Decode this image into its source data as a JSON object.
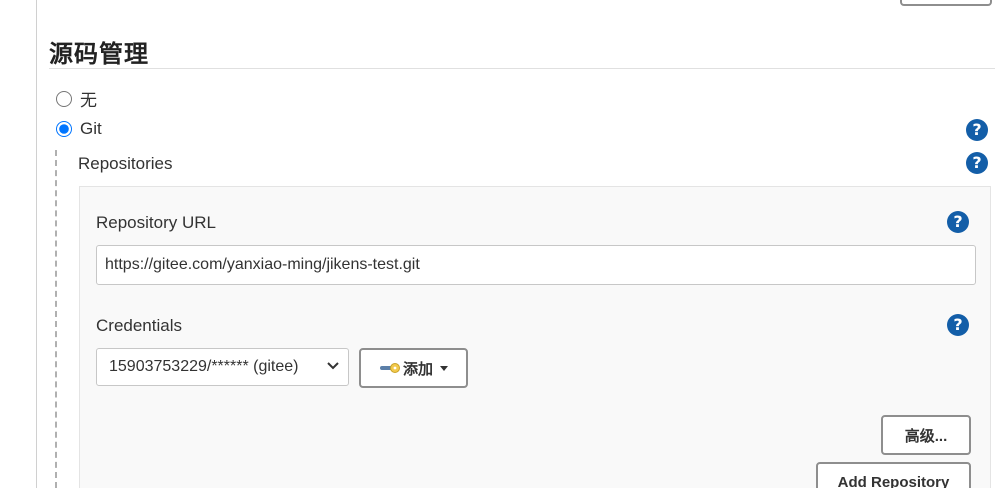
{
  "scm": {
    "title": "源码管理",
    "options": [
      {
        "label": "无",
        "selected": false
      },
      {
        "label": "Git",
        "selected": true
      }
    ]
  },
  "git": {
    "repositories_label": "Repositories",
    "repository_url": {
      "label": "Repository URL",
      "value": "https://gitee.com/yanxiao-ming/jikens-test.git"
    },
    "credentials": {
      "label": "Credentials",
      "selected": "15903753229/****** (gitee)",
      "add_button": "添加"
    },
    "advanced_button": "高级...",
    "add_repository_button": "Add Repository"
  },
  "icons": {
    "help": "help-icon",
    "key": "key-icon",
    "dropdown": "chevron-down-icon"
  },
  "colors": {
    "help_icon": "#135ea8",
    "panel_bg": "#f9f9f9",
    "button_border": "#8e8e8e"
  }
}
